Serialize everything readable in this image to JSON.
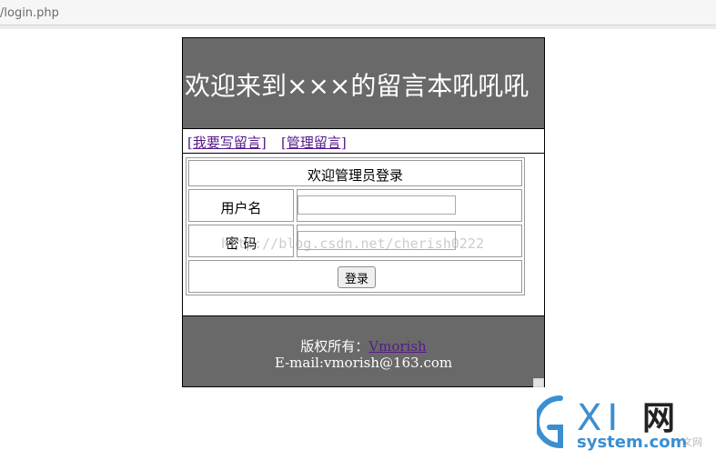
{
  "browser": {
    "url": "/login.php"
  },
  "header": {
    "title": "欢迎来到×××的留言本吼吼吼"
  },
  "nav": {
    "write_link": "[我要写留言]",
    "manage_link": "[管理留言]"
  },
  "login": {
    "heading": "欢迎管理员登录",
    "username_label": "用户名",
    "username_value": "",
    "password_label": "密 码",
    "password_value": "",
    "submit_label": "登录"
  },
  "footer": {
    "copyright_label": "版权所有：",
    "author_link": "Vmorish",
    "email_line": "E-mail:vmorish@163.com"
  },
  "watermarks": {
    "blog_url": "http://blog.csdn.net/cherish0222",
    "logo_name": "GXI网",
    "logo_domain": "system.com",
    "logo_suffix": "文网"
  },
  "colors": {
    "header_bg": "#696969",
    "link": "#551a8b",
    "logo_blue": "#3a8fd1"
  }
}
